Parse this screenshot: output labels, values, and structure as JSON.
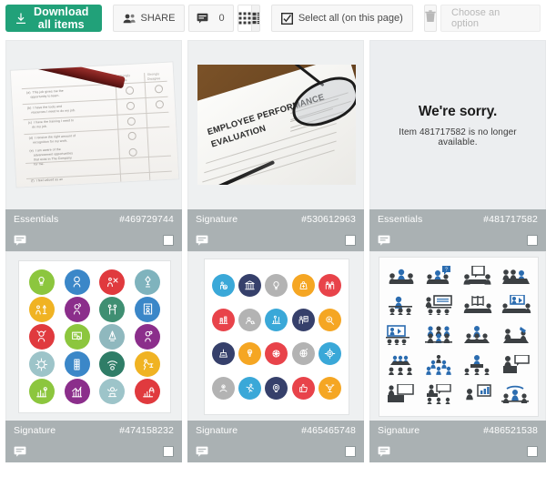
{
  "toolbar": {
    "download_label": "Download all items",
    "download_icon": "download-icon",
    "share_label": "SHARE",
    "share_icon": "people-icon",
    "comments_icon": "comment-icon",
    "comments_count": "0",
    "grid_view_icon": "grid-view-icon",
    "list_view_icon": "list-view-icon",
    "select_all_label": "Select all (on this page)",
    "select_all_icon": "checkbox-checked-icon",
    "delete_icon": "trash-icon",
    "option_select_label": "Choose an option",
    "accent_green": "#21a179",
    "meta_bar_gray": "#aab1b3",
    "thumb_bg": "#eef0f1"
  },
  "items": [
    {
      "type": "Essentials",
      "id": "#469729744",
      "thumb": "photo-survey-form-with-red-pen",
      "comment_icon": "comment-icon",
      "checkbox": "select-checkbox",
      "available": true
    },
    {
      "type": "Signature",
      "id": "#530612963",
      "thumb": "photo-employee-performance-evaluation",
      "thumb_text": "EMPLOYEE PERFORMANCE EVALUATION",
      "comment_icon": "comment-icon",
      "checkbox": "select-checkbox",
      "available": true
    },
    {
      "type": "Essentials",
      "id": "#481717582",
      "thumb": "unavailable",
      "comment_icon": "comment-icon",
      "checkbox": "select-checkbox",
      "available": false,
      "error_title": "We're sorry.",
      "error_message": "Item 481717582 is no longer available."
    },
    {
      "type": "Signature",
      "id": "#474158232",
      "thumb": "icon-sheet-colored-circles-hr",
      "comment_icon": "comment-icon",
      "checkbox": "select-checkbox",
      "available": true
    },
    {
      "type": "Signature",
      "id": "#465465748",
      "thumb": "icon-sheet-flat-circles-business",
      "comment_icon": "comment-icon",
      "checkbox": "select-checkbox",
      "available": true
    },
    {
      "type": "Signature",
      "id": "#486521538",
      "thumb": "icon-sheet-meeting-pictograms",
      "comment_icon": "comment-icon",
      "checkbox": "select-checkbox",
      "available": true
    }
  ],
  "icon_sheet_1": {
    "columns": 4,
    "rows": 5,
    "colors": [
      "#8cc63e",
      "#3b87c8",
      "#e03a3e",
      "#7fb3bd",
      "#f0b323",
      "#8b2e8b",
      "#3f8f72",
      "#3b87c8",
      "#e03a3e",
      "#8cc63e",
      "#8fb8be",
      "#8b2e8b",
      "#9dc4c9",
      "#3b87c8",
      "#2f7d67",
      "#f0b323",
      "#8cc63e",
      "#8b2e8b",
      "#9dc4c9",
      "#e03a3e"
    ]
  },
  "icon_sheet_2": {
    "columns": 5,
    "rows": 4,
    "colors": [
      "#3aa8d8",
      "#36406b",
      "#b3b3b3",
      "#f5a623",
      "#e8434a",
      "#e8434a",
      "#b3b3b3",
      "#3aa8d8",
      "#36406b",
      "#f5a623",
      "#36406b",
      "#f5a623",
      "#e8434a",
      "#b3b3b3",
      "#3aa8d8",
      "#b3b3b3",
      "#3aa8d8",
      "#36406b",
      "#e8434a",
      "#f5a623"
    ]
  },
  "icon_sheet_3": {
    "columns": 4,
    "rows": 5,
    "accent": "#2b6cb0",
    "dark": "#3c4043"
  }
}
